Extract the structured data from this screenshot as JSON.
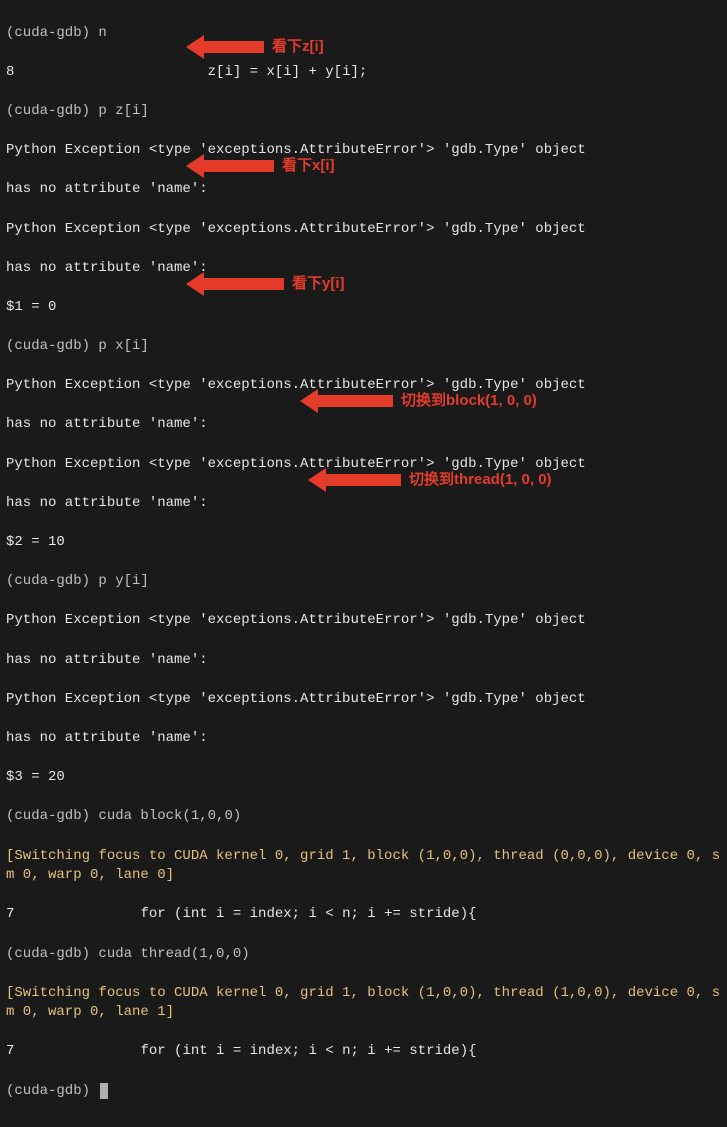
{
  "prompt": "(cuda-gdb)",
  "cmds": {
    "n": "n",
    "pz": "p z[i]",
    "px": "p x[i]",
    "py": "p y[i]",
    "block": "cuda block(1,0,0)",
    "thread": "cuda thread(1,0,0)",
    "empty": ""
  },
  "src8_num": "8",
  "src8_body": "z[i] = x[i] + y[i];",
  "src7_num": "7",
  "src7_body": "for (int i = index; i < n; i += stride){",
  "exc1": "Python Exception <type 'exceptions.AttributeError'> 'gdb.Type' object",
  "exc2": "has no attribute 'name':",
  "val1": "$1 = 0",
  "val2": "$2 = 10",
  "val3": "$3 = 20",
  "sw1a": "[Switching focus to CUDA kernel 0, grid 1, block (1,0,0), thread (0,0,0), device 0, sm 0, warp 0, lane 0]",
  "sw2a": "[Switching focus to CUDA kernel 0, grid 1, block (1,0,0), thread (1,0,0), device 0, sm 0, warp 0, lane 1]",
  "ann": {
    "z": "看下z[i]",
    "x": "看下x[i]",
    "y": "看下y[i]",
    "block": "切换到block(1, 0, 0)",
    "thread": "切换到thread(1, 0, 0)"
  }
}
